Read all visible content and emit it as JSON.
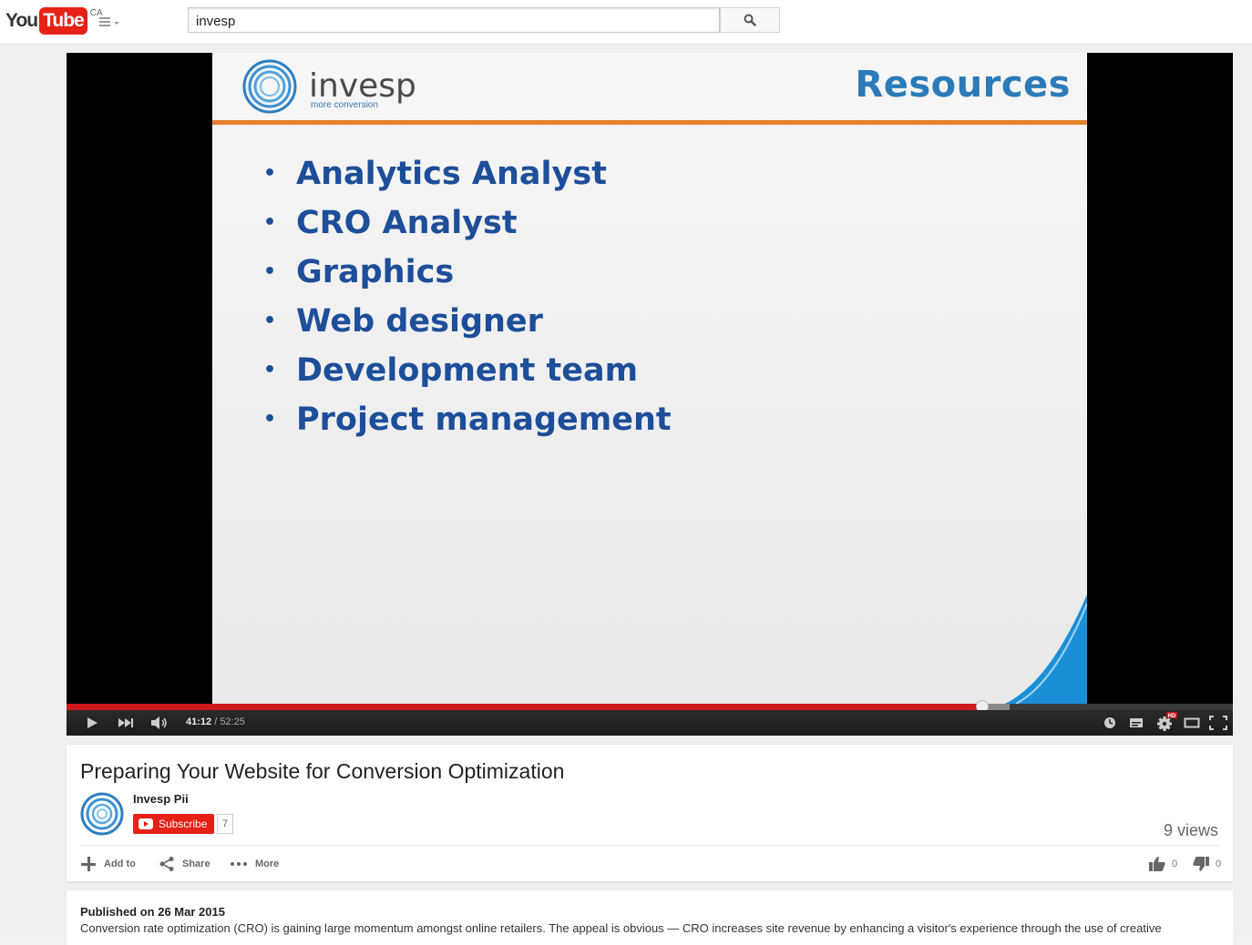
{
  "header": {
    "logo_you": "You",
    "logo_tube": "Tube",
    "logo_country": "CA",
    "search_value": "invesp"
  },
  "player": {
    "slide": {
      "brand": "invesp",
      "brand_sub": "more conversion",
      "title": "Resources",
      "bullets": [
        "Analytics Analyst",
        "CRO Analyst",
        "Graphics",
        "Web designer",
        "Development team",
        "Project management"
      ]
    },
    "time_current": "41:12",
    "time_separator": " / ",
    "time_total": "52:25",
    "progress_fraction": 0.786,
    "hd_badge": "HD"
  },
  "video": {
    "title": "Preparing Your Website for Conversion Optimization",
    "channel_name": "Invesp Pii",
    "subscribe_label": "Subscribe",
    "subscriber_count": "7",
    "views": "9 views",
    "actions": {
      "add_to": "Add to",
      "share": "Share",
      "more": "More"
    },
    "likes": "0",
    "dislikes": "0"
  },
  "description": {
    "published": "Published on 26 Mar 2015",
    "text": "Conversion rate optimization (CRO) is gaining large momentum amongst online retailers. The appeal is obvious — CRO increases site revenue by enhancing a visitor's experience through the use of creative"
  },
  "colors": {
    "brand_red": "#e62117",
    "progress_red": "#cc181e",
    "slide_blue": "#1d4e9a",
    "slide_orange": "#e4802a"
  },
  "icons": [
    "guide-icon",
    "search-icon",
    "play-icon",
    "next-icon",
    "volume-icon",
    "watch-later-icon",
    "subtitles-icon",
    "settings-icon",
    "theater-icon",
    "fullscreen-icon",
    "add-icon",
    "share-icon",
    "more-icon",
    "like-icon",
    "dislike-icon"
  ]
}
